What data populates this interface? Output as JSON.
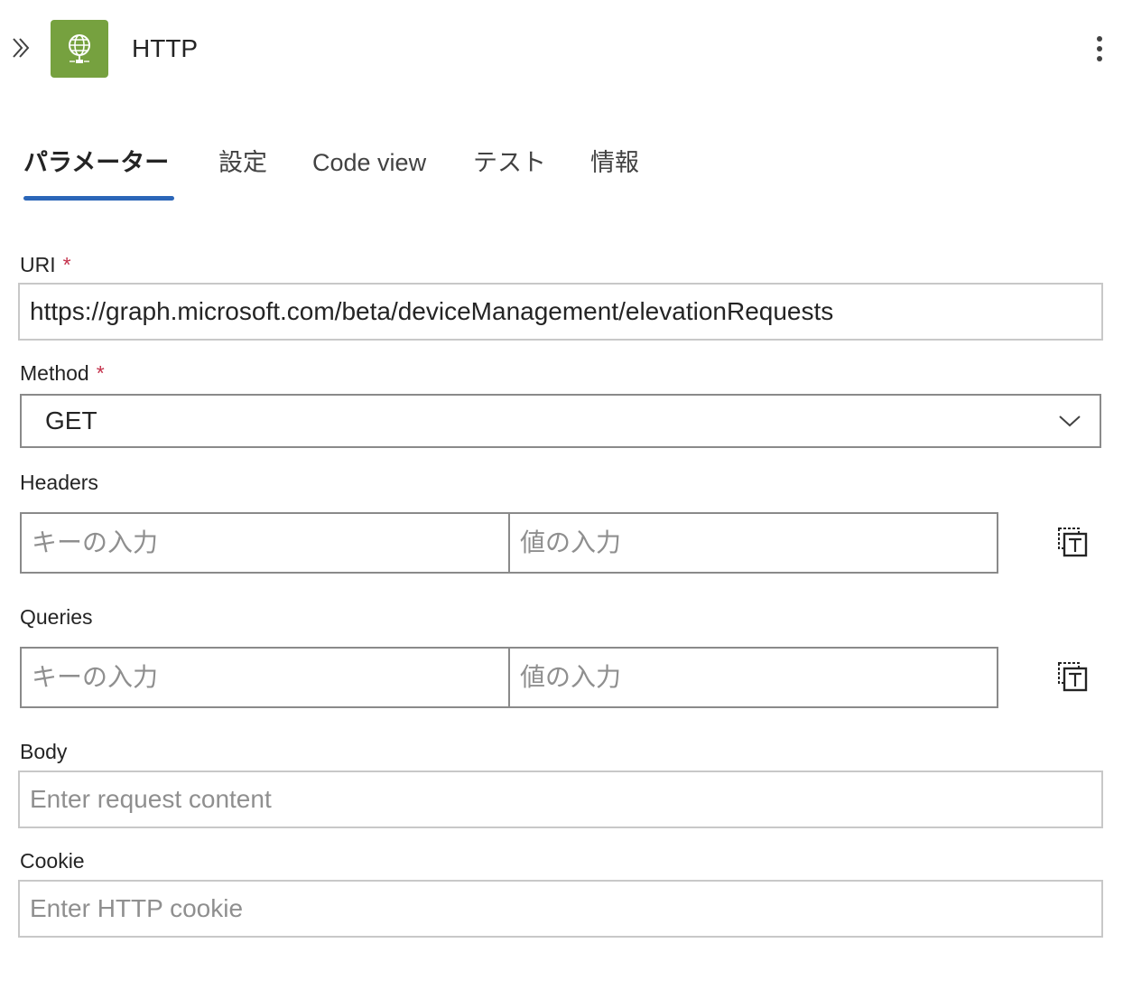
{
  "header": {
    "title": "HTTP",
    "app_icon": "globe-icon",
    "accent_color": "#76a13f"
  },
  "tabs": [
    {
      "label": "パラメーター",
      "active": true
    },
    {
      "label": "設定",
      "active": false
    },
    {
      "label": "Code view",
      "active": false
    },
    {
      "label": "テスト",
      "active": false
    },
    {
      "label": "情報",
      "active": false
    }
  ],
  "tab_accent_color": "#2b66b8",
  "fields": {
    "uri": {
      "label": "URI",
      "required_mark": "*",
      "value": "https://graph.microsoft.com/beta/deviceManagement/elevationRequests"
    },
    "method": {
      "label": "Method",
      "required_mark": "*",
      "value": "GET"
    },
    "headers": {
      "label": "Headers",
      "key_placeholder": "キーの入力",
      "value_placeholder": "値の入力"
    },
    "queries": {
      "label": "Queries",
      "key_placeholder": "キーの入力",
      "value_placeholder": "値の入力"
    },
    "body": {
      "label": "Body",
      "placeholder": "Enter request content"
    },
    "cookie": {
      "label": "Cookie",
      "placeholder": "Enter HTTP cookie"
    }
  },
  "icons": {
    "collapse": "double-chevron-right-icon",
    "more": "more-vertical-icon",
    "dropdown": "chevron-down-icon",
    "text_mode": "switch-to-text-mode-icon"
  }
}
